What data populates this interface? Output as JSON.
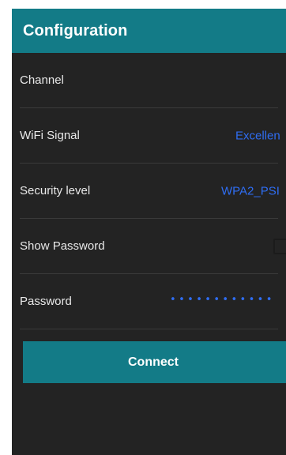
{
  "appbar": {
    "title": "Configuration",
    "color": "#137b87"
  },
  "settings": {
    "channel": {
      "label": "Channel",
      "value": ""
    },
    "wifi_signal": {
      "label": "WiFi Signal",
      "value": "Excellen"
    },
    "security_level": {
      "label": "Security level",
      "value": "WPA2_PSI"
    },
    "show_password": {
      "label": "Show Password",
      "checked": false
    },
    "password": {
      "label": "Password",
      "masked_value": "••••••••••••"
    }
  },
  "actions": {
    "connect_label": "Connect"
  },
  "colors": {
    "background": "#232323",
    "accent": "#137b87",
    "value_text": "#2f6df2",
    "label_text": "#e9e9e9"
  }
}
